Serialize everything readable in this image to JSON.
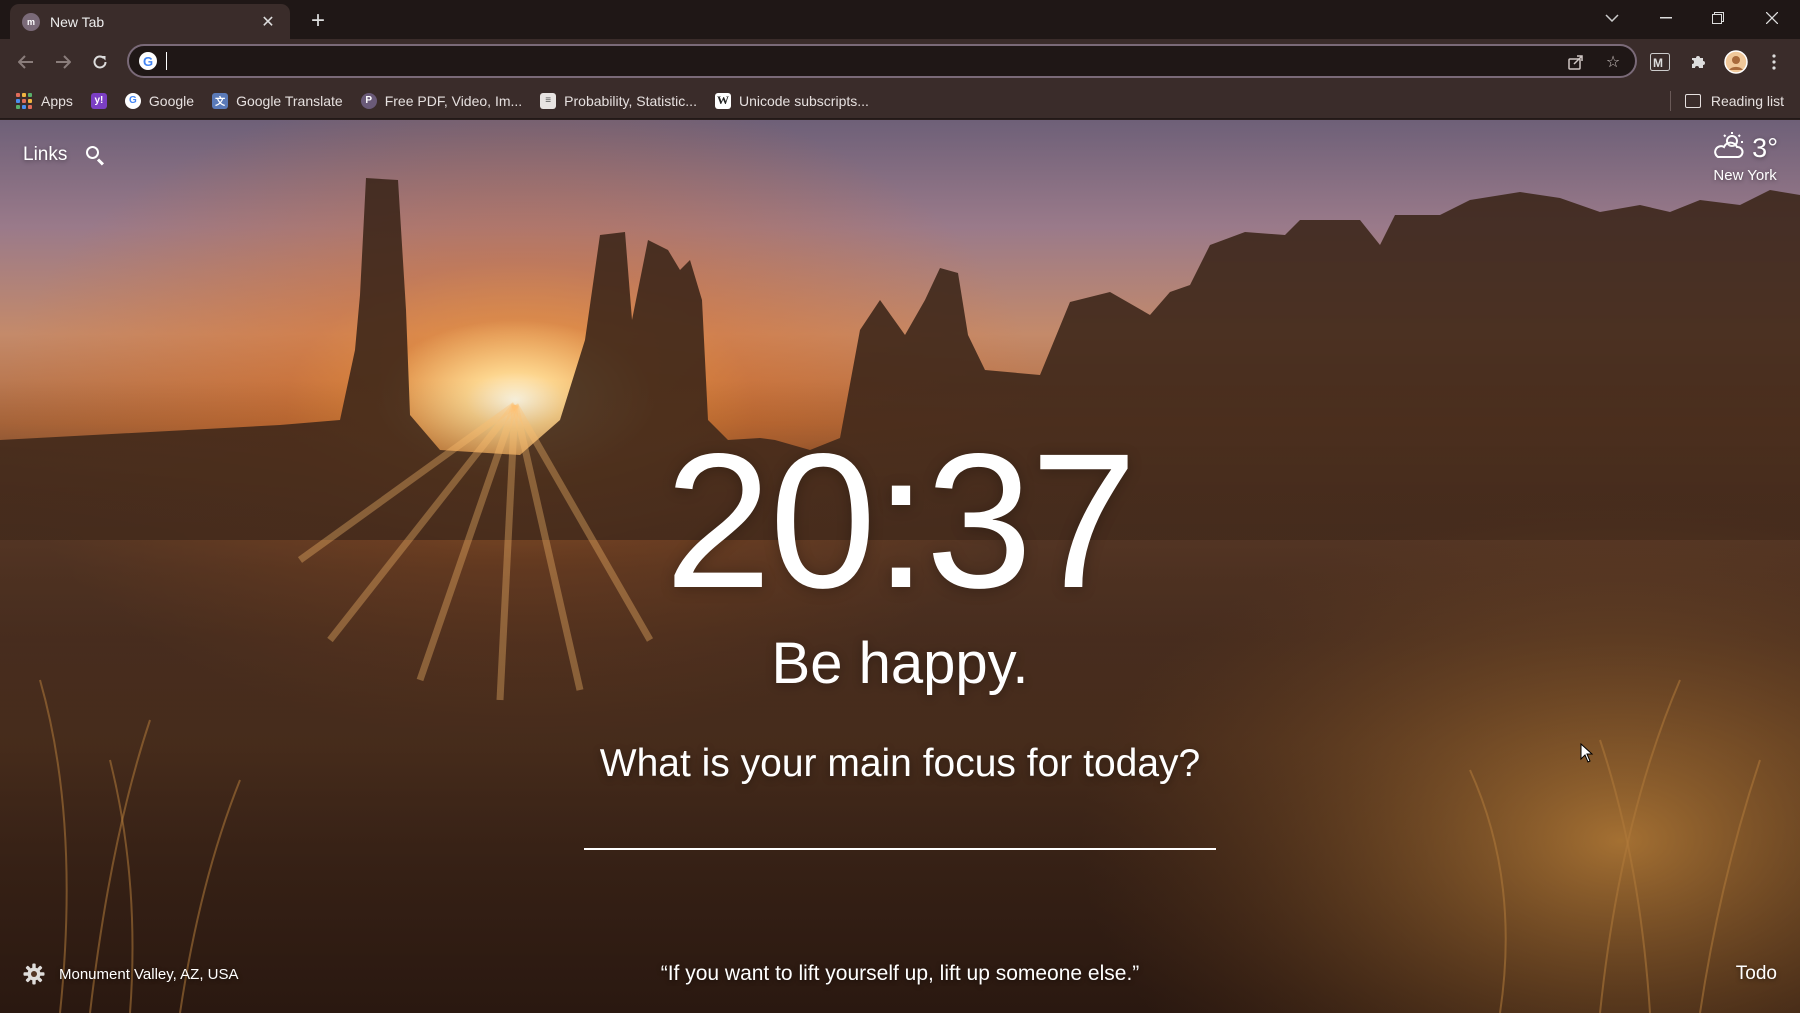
{
  "browser": {
    "tab": {
      "title": "New Tab",
      "favicon": "momentum-icon"
    },
    "omnibox": {
      "value": "",
      "placeholder": ""
    },
    "bookmarks": [
      {
        "label": "Apps",
        "icon": "apps-grid-icon"
      },
      {
        "label": "",
        "icon": "yahoo-icon"
      },
      {
        "label": "Google",
        "icon": "google-icon"
      },
      {
        "label": "Google Translate",
        "icon": "google-translate-icon"
      },
      {
        "label": "Free PDF, Video, Im...",
        "icon": "pdf-tool-icon"
      },
      {
        "label": "Probability, Statistic...",
        "icon": "page-icon"
      },
      {
        "label": "Unicode subscripts...",
        "icon": "wikipedia-icon"
      }
    ],
    "reading_list": "Reading list"
  },
  "momentum": {
    "links": "Links",
    "weather": {
      "temp": "3°",
      "city": "New York",
      "icon": "partly-cloudy-icon"
    },
    "clock": "20:37",
    "mantra": "Be happy.",
    "focus_question": "What is your main focus for today?",
    "focus_value": "",
    "location": "Monument Valley, AZ, USA",
    "quote": "“If you want to lift yourself up, lift up someone else.”",
    "todo": "Todo"
  },
  "colors": {
    "chrome_dark": "#1f1716",
    "chrome_toolbar": "#3a2c2a",
    "omnibox_border": "#7a6a78",
    "sun": "#fff4d6"
  }
}
